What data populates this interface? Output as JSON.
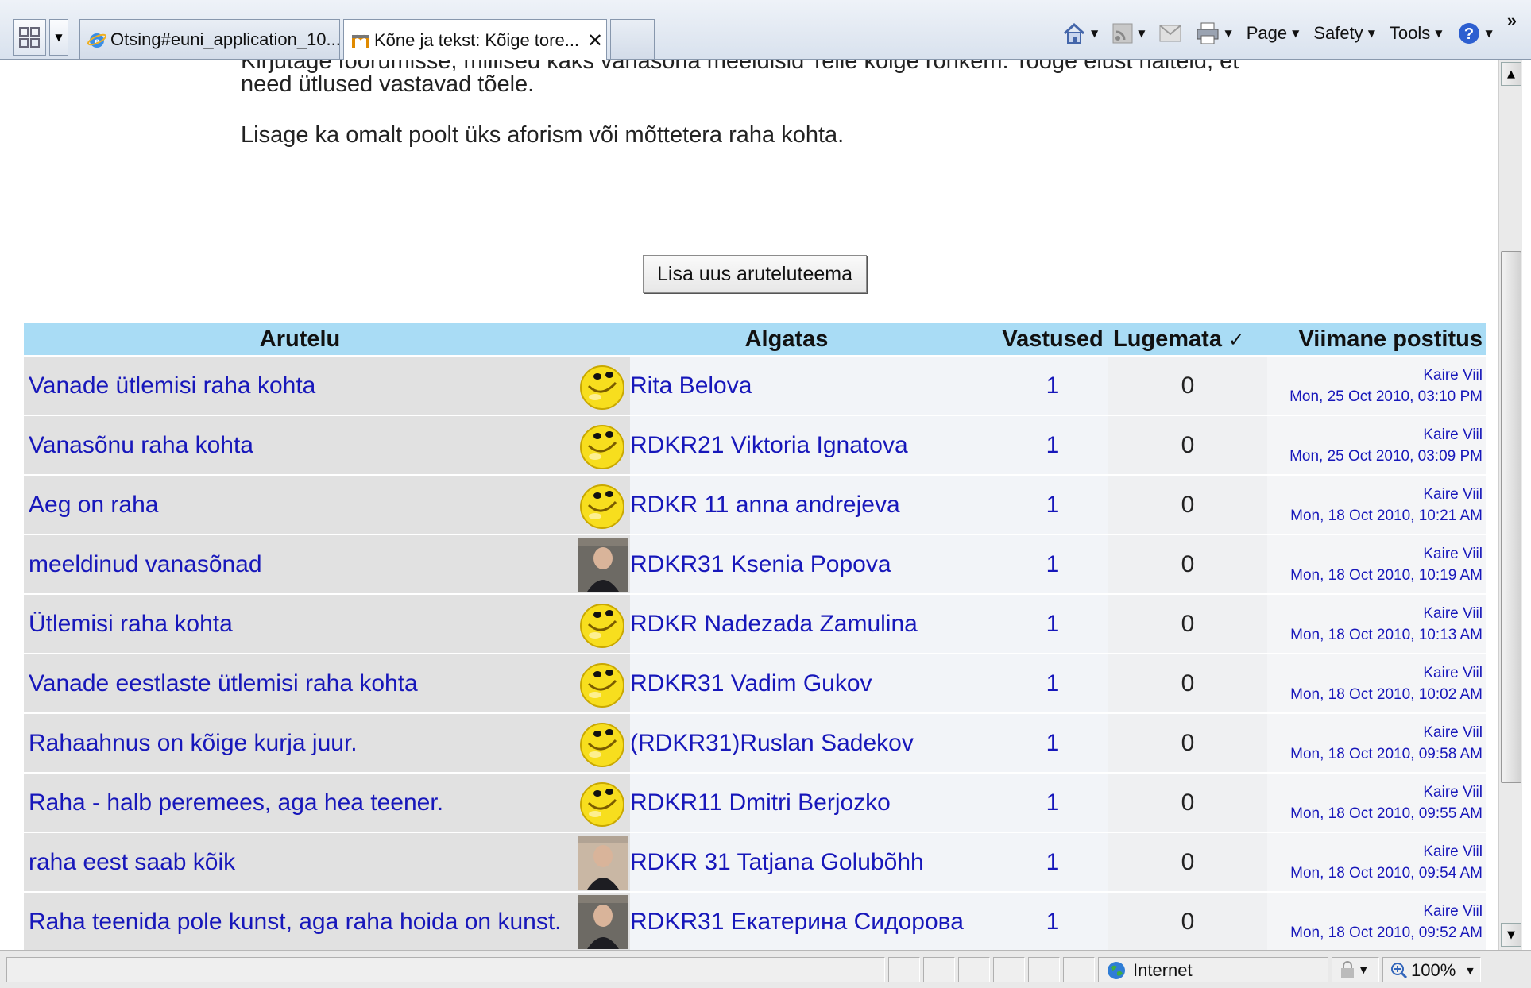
{
  "browser": {
    "tabs": [
      {
        "title": "Otsing#euni_application_10...",
        "active": false
      },
      {
        "title": "Kõne ja tekst: Kõige tore...",
        "active": true
      }
    ],
    "commands": {
      "page": "Page",
      "safety": "Safety",
      "tools": "Tools",
      "chevrons": "»"
    }
  },
  "intro": {
    "cut_line": "Kirjutage foorumisse, millised kaks vanasõna meeldisid Teile kõige rohkem. Tooge elust näiteid, et",
    "line2": "need ütlused vastavad tõele.",
    "line3": "Lisage ka omalt poolt üks aforism või mõttetera raha kohta."
  },
  "add_topic_button": "Lisa uus aruteluteema",
  "table": {
    "headers": {
      "discussion": "Arutelu",
      "started_by": "Algatas",
      "replies": "Vastused",
      "unread": "Lugemata",
      "unread_mark": "✓",
      "last_post": "Viimane postitus"
    },
    "rows": [
      {
        "topic": "Vanade ütlemisi raha kohta",
        "avatar": "smiley",
        "author": "Rita Belova",
        "replies": "1",
        "unread": "0",
        "last_by": "Kaire Viil",
        "last_date": "Mon, 25 Oct 2010, 03:10 PM"
      },
      {
        "topic": "Vanasõnu raha kohta",
        "avatar": "smiley",
        "author": "RDKR21 Viktoria Ignatova",
        "replies": "1",
        "unread": "0",
        "last_by": "Kaire Viil",
        "last_date": "Mon, 25 Oct 2010, 03:09 PM"
      },
      {
        "topic": "Aeg on raha",
        "avatar": "smiley",
        "author": "RDKR 11 anna andrejeva",
        "replies": "1",
        "unread": "0",
        "last_by": "Kaire Viil",
        "last_date": "Mon, 18 Oct 2010, 10:21 AM"
      },
      {
        "topic": "meeldinud vanasõnad",
        "avatar": "photo",
        "author": "RDKR31 Ksenia Popova",
        "replies": "1",
        "unread": "0",
        "last_by": "Kaire Viil",
        "last_date": "Mon, 18 Oct 2010, 10:19 AM"
      },
      {
        "topic": "Ütlemisi raha kohta",
        "avatar": "smiley",
        "author": "RDKR Nadezada Zamulina",
        "replies": "1",
        "unread": "0",
        "last_by": "Kaire Viil",
        "last_date": "Mon, 18 Oct 2010, 10:13 AM"
      },
      {
        "topic": "Vanade eestlaste ütlemisi raha kohta",
        "avatar": "smiley",
        "author": "RDKR31 Vadim Gukov",
        "replies": "1",
        "unread": "0",
        "last_by": "Kaire Viil",
        "last_date": "Mon, 18 Oct 2010, 10:02 AM"
      },
      {
        "topic": "Rahaahnus on kõige kurja juur.",
        "avatar": "smiley",
        "author": "(RDKR31)Ruslan Sadekov",
        "replies": "1",
        "unread": "0",
        "last_by": "Kaire Viil",
        "last_date": "Mon, 18 Oct 2010, 09:58 AM"
      },
      {
        "topic": "Raha - halb peremees, aga hea teener.",
        "avatar": "smiley",
        "author": "RDKR11 Dmitri Berjozko",
        "replies": "1",
        "unread": "0",
        "last_by": "Kaire Viil",
        "last_date": "Mon, 18 Oct 2010, 09:55 AM"
      },
      {
        "topic": "raha eest saab kõik",
        "avatar": "photo",
        "author": "RDKR 31 Tatjana Golubõhh",
        "replies": "1",
        "unread": "0",
        "last_by": "Kaire Viil",
        "last_date": "Mon, 18 Oct 2010, 09:54 AM"
      },
      {
        "topic": "Raha teenida pole kunst, aga raha hoida on kunst.",
        "avatar": "photo",
        "author": "RDKR31 Екатерина Сидорова",
        "replies": "1",
        "unread": "0",
        "last_by": "Kaire Viil",
        "last_date": "Mon, 18 Oct 2010, 09:52 AM"
      }
    ]
  },
  "status": {
    "zone": "Internet",
    "zoom": "100%"
  },
  "colors": {
    "header_bg": "#a9dcf5",
    "link": "#1717ba",
    "topic_bg": "#e1e1e1"
  }
}
